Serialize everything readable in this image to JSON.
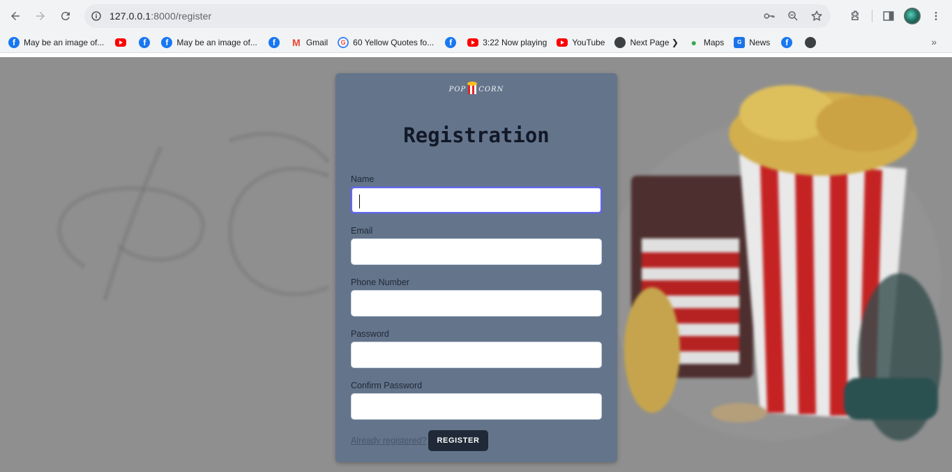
{
  "browser": {
    "url_host": "127.0.0.1",
    "url_rest": ":8000/register",
    "bookmarks": [
      {
        "label": "May be an image of...",
        "icon": "facebook-icon"
      },
      {
        "label": "",
        "icon": "youtube-icon"
      },
      {
        "label": "",
        "icon": "facebook-icon"
      },
      {
        "label": "May be an image of...",
        "icon": "facebook-icon"
      },
      {
        "label": "",
        "icon": "facebook-icon"
      },
      {
        "label": "Gmail",
        "icon": "gmail-icon"
      },
      {
        "label": "60 Yellow Quotes fo...",
        "icon": "google-icon"
      },
      {
        "label": "",
        "icon": "facebook-icon"
      },
      {
        "label": "3:22 Now playing",
        "icon": "youtube-icon"
      },
      {
        "label": "YouTube",
        "icon": "youtube-icon"
      },
      {
        "label": "Next Page ❯",
        "icon": "globe-icon"
      },
      {
        "label": "Maps",
        "icon": "maps-icon"
      },
      {
        "label": "News",
        "icon": "news-icon"
      },
      {
        "label": "",
        "icon": "facebook-icon"
      },
      {
        "label": "",
        "icon": "globe-icon"
      }
    ]
  },
  "page": {
    "logo_text_left": "POP",
    "logo_text_right": "CORN",
    "title": "Registration",
    "fields": {
      "name": {
        "label": "Name",
        "value": ""
      },
      "email": {
        "label": "Email",
        "value": ""
      },
      "phone": {
        "label": "Phone Number",
        "value": ""
      },
      "password": {
        "label": "Password",
        "value": ""
      },
      "confirm": {
        "label": "Confirm Password",
        "value": ""
      }
    },
    "already_registered_link": "Already registered?",
    "register_button": "REGISTER"
  },
  "colors": {
    "card": "#64748b",
    "button": "#1f2937",
    "focus_ring": "#6366f1"
  }
}
